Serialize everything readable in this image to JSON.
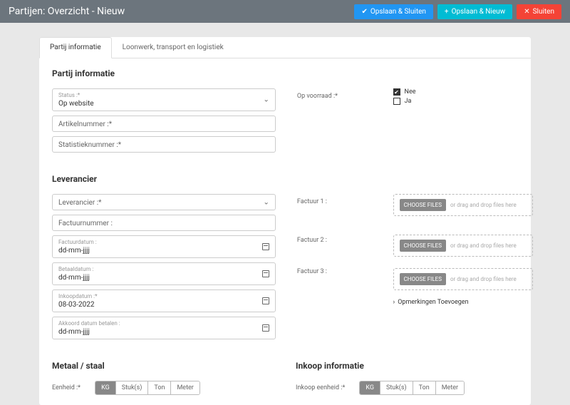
{
  "header": {
    "title": "Partijen: Overzicht - Nieuw",
    "save_close": "Opslaan & Sluiten",
    "save_new": "Opslaan & Nieuw",
    "close": "Sluiten"
  },
  "tabs": [
    "Partij informatie",
    "Loonwerk, transport en logistiek"
  ],
  "section1": {
    "title": "Partij informatie",
    "status_label": "Status :*",
    "status_value": "Op website",
    "artikel_label": "Artikelnummer :*",
    "statistiek_label": "Statistieknummer :*",
    "voorraad_label": "Op voorraad :*",
    "nee": "Nee",
    "ja": "Ja"
  },
  "section2": {
    "title": "Leverancier",
    "lev_label": "Leverancier :*",
    "factuurnr_label": "Factuurnummer :",
    "factuurdatum_label": "Factuurdatum :",
    "factuurdatum_value": "dd-mm-jjjj",
    "betaaldatum_label": "Betaaldatum :",
    "betaaldatum_value": "dd-mm-jjjj",
    "inkoopdatum_label": "Inkoopdatum :*",
    "inkoopdatum_value": "08-03-2022",
    "akkoord_label": "Akkoord datum betalen :",
    "akkoord_value": "dd-mm-jjjj",
    "factuur1": "Factuur 1 :",
    "factuur2": "Factuur 2 :",
    "factuur3": "Factuur 3 :",
    "choose": "CHOOSE FILES",
    "drop": "or drag and drop files here",
    "opmerking": "Opmerkingen Toevoegen"
  },
  "section3": {
    "metaal_title": "Metaal / staal",
    "eenheid_label": "Eenheid :*",
    "inkoop_title": "Inkoop informatie",
    "inkoop_eenheid_label": "Inkoop eenheid :*",
    "units": [
      "KG",
      "Stuk(s)",
      "Ton",
      "Meter"
    ]
  }
}
